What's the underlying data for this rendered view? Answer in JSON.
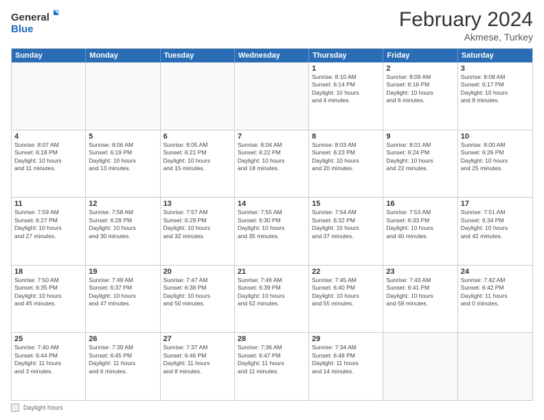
{
  "header": {
    "logo_line1": "General",
    "logo_line2": "Blue",
    "title": "February 2024",
    "location": "Akmese, Turkey"
  },
  "calendar": {
    "days_of_week": [
      "Sunday",
      "Monday",
      "Tuesday",
      "Wednesday",
      "Thursday",
      "Friday",
      "Saturday"
    ],
    "rows": [
      [
        {
          "day": "",
          "info": ""
        },
        {
          "day": "",
          "info": ""
        },
        {
          "day": "",
          "info": ""
        },
        {
          "day": "",
          "info": ""
        },
        {
          "day": "1",
          "info": "Sunrise: 8:10 AM\nSunset: 6:14 PM\nDaylight: 10 hours\nand 4 minutes."
        },
        {
          "day": "2",
          "info": "Sunrise: 8:09 AM\nSunset: 6:16 PM\nDaylight: 10 hours\nand 6 minutes."
        },
        {
          "day": "3",
          "info": "Sunrise: 8:08 AM\nSunset: 6:17 PM\nDaylight: 10 hours\nand 8 minutes."
        }
      ],
      [
        {
          "day": "4",
          "info": "Sunrise: 8:07 AM\nSunset: 6:18 PM\nDaylight: 10 hours\nand 11 minutes."
        },
        {
          "day": "5",
          "info": "Sunrise: 8:06 AM\nSunset: 6:19 PM\nDaylight: 10 hours\nand 13 minutes."
        },
        {
          "day": "6",
          "info": "Sunrise: 8:05 AM\nSunset: 6:21 PM\nDaylight: 10 hours\nand 15 minutes."
        },
        {
          "day": "7",
          "info": "Sunrise: 8:04 AM\nSunset: 6:22 PM\nDaylight: 10 hours\nand 18 minutes."
        },
        {
          "day": "8",
          "info": "Sunrise: 8:03 AM\nSunset: 6:23 PM\nDaylight: 10 hours\nand 20 minutes."
        },
        {
          "day": "9",
          "info": "Sunrise: 8:01 AM\nSunset: 6:24 PM\nDaylight: 10 hours\nand 22 minutes."
        },
        {
          "day": "10",
          "info": "Sunrise: 8:00 AM\nSunset: 6:26 PM\nDaylight: 10 hours\nand 25 minutes."
        }
      ],
      [
        {
          "day": "11",
          "info": "Sunrise: 7:59 AM\nSunset: 6:27 PM\nDaylight: 10 hours\nand 27 minutes."
        },
        {
          "day": "12",
          "info": "Sunrise: 7:58 AM\nSunset: 6:28 PM\nDaylight: 10 hours\nand 30 minutes."
        },
        {
          "day": "13",
          "info": "Sunrise: 7:57 AM\nSunset: 6:29 PM\nDaylight: 10 hours\nand 32 minutes."
        },
        {
          "day": "14",
          "info": "Sunrise: 7:55 AM\nSunset: 6:30 PM\nDaylight: 10 hours\nand 35 minutes."
        },
        {
          "day": "15",
          "info": "Sunrise: 7:54 AM\nSunset: 6:32 PM\nDaylight: 10 hours\nand 37 minutes."
        },
        {
          "day": "16",
          "info": "Sunrise: 7:53 AM\nSunset: 6:33 PM\nDaylight: 10 hours\nand 40 minutes."
        },
        {
          "day": "17",
          "info": "Sunrise: 7:51 AM\nSunset: 6:34 PM\nDaylight: 10 hours\nand 42 minutes."
        }
      ],
      [
        {
          "day": "18",
          "info": "Sunrise: 7:50 AM\nSunset: 6:35 PM\nDaylight: 10 hours\nand 45 minutes."
        },
        {
          "day": "19",
          "info": "Sunrise: 7:49 AM\nSunset: 6:37 PM\nDaylight: 10 hours\nand 47 minutes."
        },
        {
          "day": "20",
          "info": "Sunrise: 7:47 AM\nSunset: 6:38 PM\nDaylight: 10 hours\nand 50 minutes."
        },
        {
          "day": "21",
          "info": "Sunrise: 7:46 AM\nSunset: 6:39 PM\nDaylight: 10 hours\nand 52 minutes."
        },
        {
          "day": "22",
          "info": "Sunrise: 7:45 AM\nSunset: 6:40 PM\nDaylight: 10 hours\nand 55 minutes."
        },
        {
          "day": "23",
          "info": "Sunrise: 7:43 AM\nSunset: 6:41 PM\nDaylight: 10 hours\nand 58 minutes."
        },
        {
          "day": "24",
          "info": "Sunrise: 7:42 AM\nSunset: 6:42 PM\nDaylight: 11 hours\nand 0 minutes."
        }
      ],
      [
        {
          "day": "25",
          "info": "Sunrise: 7:40 AM\nSunset: 6:44 PM\nDaylight: 11 hours\nand 3 minutes."
        },
        {
          "day": "26",
          "info": "Sunrise: 7:39 AM\nSunset: 6:45 PM\nDaylight: 11 hours\nand 6 minutes."
        },
        {
          "day": "27",
          "info": "Sunrise: 7:37 AM\nSunset: 6:46 PM\nDaylight: 11 hours\nand 8 minutes."
        },
        {
          "day": "28",
          "info": "Sunrise: 7:36 AM\nSunset: 6:47 PM\nDaylight: 11 hours\nand 11 minutes."
        },
        {
          "day": "29",
          "info": "Sunrise: 7:34 AM\nSunset: 6:48 PM\nDaylight: 11 hours\nand 14 minutes."
        },
        {
          "day": "",
          "info": ""
        },
        {
          "day": "",
          "info": ""
        }
      ]
    ]
  },
  "footer": {
    "box_label": "Daylight hours"
  }
}
